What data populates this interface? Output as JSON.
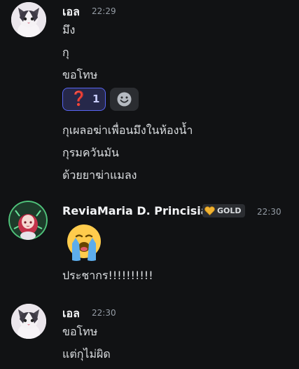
{
  "messages": [
    {
      "username": "เอล",
      "time": "22:29",
      "lines": [
        "มึง",
        "กุ",
        "ขอโทษ"
      ],
      "reaction": {
        "emoji": "❓",
        "count": "1",
        "icon": "question-mark-icon"
      },
      "add_reaction_icon": "smiley-icon",
      "more_lines": [
        "กุเผลอฆ่าเพื่อนมึงในห้องน้ำ",
        "กุรมควันมัน",
        "ด้วยยาฆ่าแมลง"
      ]
    },
    {
      "username": "ReviaMaria D. Princisia",
      "badge": {
        "label": "GOLD",
        "icon": "gold-heart-icon",
        "color": "#f0b232"
      },
      "time": "22:30",
      "emoji": "loudly-crying-face-icon",
      "lines": [
        "ประชากร!!!!!!!!!!"
      ]
    },
    {
      "username": "เอล",
      "time": "22:30",
      "lines": [
        "ขอโทษ",
        "แต่กุไม่ผิด"
      ]
    }
  ],
  "colors": {
    "background": "#111214",
    "text": "#dbdee1",
    "timestamp": "#949ba4",
    "reaction_border": "#5865f2",
    "reaction_bg": "#26284a"
  }
}
